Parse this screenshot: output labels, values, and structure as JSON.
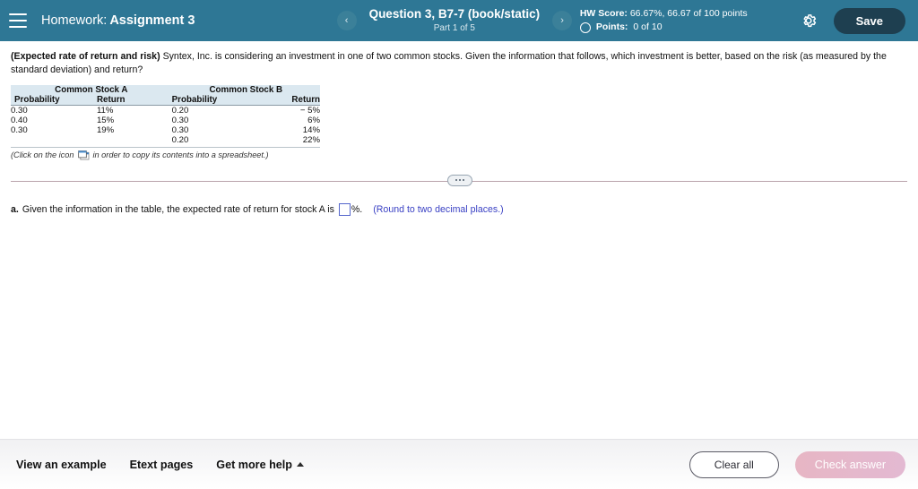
{
  "header": {
    "menu_icon": "hamburger-icon",
    "course_label": "Homework:",
    "assignment_name": "Assignment 3",
    "prev_icon": "chevron-left-icon",
    "next_icon": "chevron-right-icon",
    "question_title": "Question 3, B7-7 (book/static)",
    "part_label": "Part 1 of 5",
    "hw_score_label": "HW Score:",
    "hw_score_value": "66.67%, 66.67 of 100 points",
    "points_label": "Points:",
    "points_value": "0 of 10",
    "settings_icon": "gear-icon",
    "save_label": "Save",
    "bar_color": "#2e7795",
    "save_color": "#1e3f50"
  },
  "question": {
    "topic": "(Expected rate of return and risk)",
    "body": "Syntex, Inc. is considering an investment in one of two common stocks.  Given the information that follows, which investment is better, based on the risk (as measured by the standard deviation) and return?"
  },
  "table": {
    "group_headers": [
      "Common Stock A",
      "Common Stock B"
    ],
    "column_headers": [
      "Probability",
      "Return",
      "Probability",
      "Return"
    ],
    "rows": [
      [
        "0.30",
        "11%",
        "0.20",
        "− 5%"
      ],
      [
        "0.40",
        "15%",
        "0.30",
        "6%"
      ],
      [
        "0.30",
        "19%",
        "0.30",
        "14%"
      ],
      [
        "",
        "",
        "0.20",
        "22%"
      ]
    ],
    "header_bg": "#dbe8f0",
    "copy_note_prefix": "(Click on the icon",
    "copy_icon": "spreadsheet-copy-icon",
    "copy_note_suffix": "in order to copy its contents into a spreadsheet.)"
  },
  "divider": {
    "handle_icon": "ellipsis-pill-handle",
    "line_color": "#b9a3ab"
  },
  "answer": {
    "letter": "a.",
    "text_before": "Given the information in the table, the expected rate of return for stock A is",
    "input_value": "",
    "input_placeholder": "",
    "unit": "%.",
    "rounding_note": "(Round to two decimal places.)",
    "note_color": "#3a41c4"
  },
  "footer": {
    "links": [
      {
        "label": "View an example",
        "has_caret": false
      },
      {
        "label": "Etext pages",
        "has_caret": false
      },
      {
        "label": "Get more help",
        "has_caret": true
      }
    ],
    "clear_label": "Clear all",
    "check_label": "Check answer",
    "check_color": "#e7b6c4"
  }
}
